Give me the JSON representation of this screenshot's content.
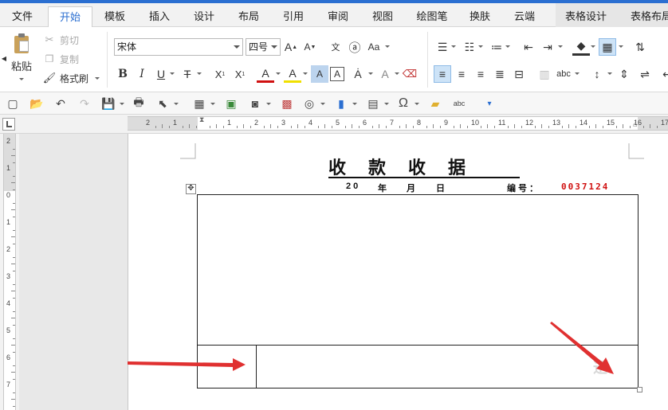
{
  "menu": {
    "tabs": [
      {
        "label": "文件"
      },
      {
        "label": "开始"
      },
      {
        "label": "模板"
      },
      {
        "label": "插入"
      },
      {
        "label": "设计"
      },
      {
        "label": "布局"
      },
      {
        "label": "引用"
      },
      {
        "label": "审阅"
      },
      {
        "label": "视图"
      },
      {
        "label": "绘图笔"
      },
      {
        "label": "换肤"
      },
      {
        "label": "云端"
      },
      {
        "label": "表格设计"
      },
      {
        "label": "表格布局"
      }
    ]
  },
  "ribbon": {
    "paste_label": "粘贴",
    "cut_label": "剪切",
    "copy_label": "复制",
    "format_painter_label": "格式刷",
    "font_name": "宋体",
    "font_size": "四号"
  },
  "document": {
    "title": "收款收据",
    "date_prefix": "20",
    "year_label": "年",
    "month_label": "月",
    "day_label": "日",
    "number_label": "编号：",
    "serial_number": "0037124",
    "watermark": "迅"
  },
  "ruler": {
    "h_labels": [
      "2",
      "1",
      "",
      "1",
      "2",
      "3",
      "4",
      "5",
      "6",
      "7",
      "8",
      "9",
      "10",
      "11",
      "12",
      "13",
      "14",
      "15",
      "16",
      "17"
    ],
    "v_labels": [
      "2",
      "1",
      "0",
      "1",
      "2",
      "3",
      "4",
      "5",
      "6",
      "7"
    ]
  },
  "colors": {
    "accent": "#2b6fd1",
    "serial_red": "#d01010",
    "arrow_red": "#e03030"
  }
}
